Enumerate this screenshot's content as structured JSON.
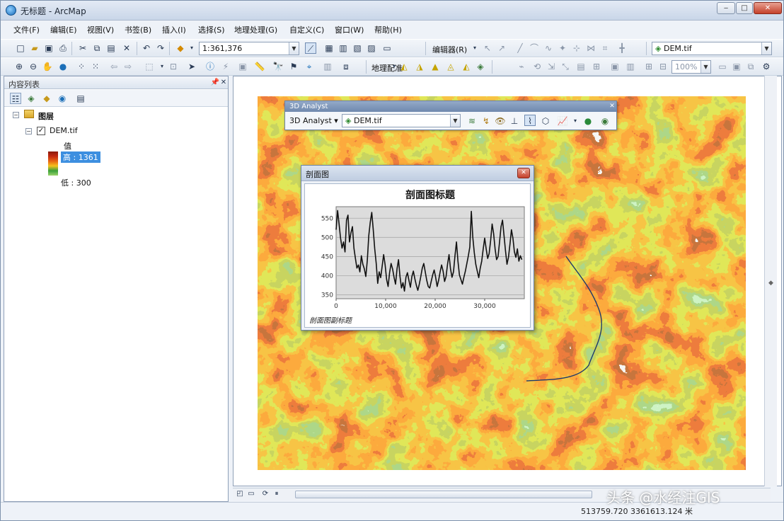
{
  "window": {
    "title": "无标题 - ArcMap",
    "minimize": "‒",
    "maximize": "□",
    "close": "✕"
  },
  "menu": [
    "文件(F)",
    "编辑(E)",
    "视图(V)",
    "书签(B)",
    "插入(I)",
    "选择(S)",
    "地理处理(G)",
    "自定义(C)",
    "窗口(W)",
    "帮助(H)"
  ],
  "toolbar": {
    "scale": "1:361,376",
    "editor_label": "编辑器(R)",
    "layer_combo": "DEM.tif",
    "georef_label": "地理配准",
    "zoom_percent": "100%"
  },
  "toc": {
    "title": "内容列表",
    "layers_group": "图层",
    "layer_name": "DEM.tif",
    "legend_heading": "值",
    "legend_high": "高 : 1361",
    "legend_low": "低 : 300",
    "legend_colors": [
      "#8b1a0c",
      "#c2290f",
      "#e86412",
      "#f6c21b",
      "#3aa03a",
      "#9bd46b"
    ]
  },
  "analyst3d": {
    "title": "3D Analyst",
    "menu_label": "3D Analyst ▾",
    "layer_combo": "DEM.tif"
  },
  "profile": {
    "window_title": "剖面图",
    "caption": "剖面图副标题"
  },
  "chart_data": {
    "type": "line",
    "title": "剖面图标题",
    "xlabel": "",
    "ylabel": "",
    "yticks": [
      "550",
      "500",
      "450",
      "400",
      "350"
    ],
    "xticks": [
      "0",
      "10,000",
      "20,000",
      "30,000"
    ],
    "ylim": [
      340,
      580
    ],
    "xlim": [
      0,
      38000
    ],
    "series": [
      {
        "color": "#111111",
        "x": [
          0,
          300,
          600,
          900,
          1200,
          1500,
          1800,
          2100,
          2400,
          2700,
          3000,
          3300,
          3600,
          3900,
          4200,
          4500,
          4800,
          5100,
          5400,
          5700,
          6000,
          6300,
          6600,
          6900,
          7200,
          7500,
          7800,
          8100,
          8400,
          8700,
          9000,
          9300,
          9600,
          9900,
          10200,
          10500,
          10800,
          11100,
          11400,
          11700,
          12000,
          12300,
          12600,
          12900,
          13200,
          13500,
          13800,
          14100,
          14400,
          14700,
          15000,
          15300,
          15600,
          15900,
          16200,
          16500,
          16800,
          17100,
          17400,
          17700,
          18000,
          18300,
          18600,
          18900,
          19200,
          19500,
          19800,
          20100,
          20400,
          20700,
          21000,
          21300,
          21600,
          21900,
          22200,
          22500,
          22800,
          23100,
          23400,
          23700,
          24000,
          24300,
          24600,
          24900,
          25200,
          25500,
          25800,
          26100,
          26400,
          26700,
          27000,
          27300,
          27600,
          27900,
          28200,
          28500,
          28800,
          29100,
          29400,
          29700,
          30000,
          30300,
          30600,
          30900,
          31200,
          31500,
          31800,
          32100,
          32400,
          32700,
          33000,
          33300,
          33600,
          33900,
          34200,
          34500,
          34800,
          35100,
          35400,
          35700,
          36000,
          36300,
          36600,
          36900,
          37200,
          37500
        ],
        "y": [
          520,
          570,
          535,
          498,
          472,
          488,
          462,
          545,
          558,
          488,
          512,
          528,
          472,
          445,
          420,
          428,
          410,
          452,
          430,
          418,
          398,
          440,
          505,
          540,
          565,
          520,
          470,
          432,
          380,
          410,
          395,
          425,
          455,
          428,
          390,
          372,
          408,
          432,
          418,
          396,
          378,
          418,
          442,
          398,
          368,
          382,
          360,
          396,
          408,
          388,
          370,
          398,
          412,
          392,
          375,
          362,
          378,
          398,
          420,
          432,
          410,
          388,
          372,
          368,
          385,
          402,
          415,
          396,
          372,
          388,
          410,
          428,
          412,
          385,
          398,
          430,
          455,
          418,
          396,
          410,
          452,
          488,
          438,
          402,
          390,
          378,
          396,
          412,
          432,
          452,
          475,
          568,
          500,
          460,
          430,
          412,
          395,
          420,
          438,
          470,
          498,
          470,
          445,
          458,
          492,
          535,
          510,
          470,
          442,
          450,
          488,
          528,
          545,
          505,
          465,
          430,
          448,
          482,
          520,
          498,
          462,
          448,
          470,
          438,
          452,
          442
        ]
      }
    ]
  },
  "status": {
    "coords": "513759.720  3361613.124 米"
  },
  "watermark": "头条 @水经注GIS"
}
